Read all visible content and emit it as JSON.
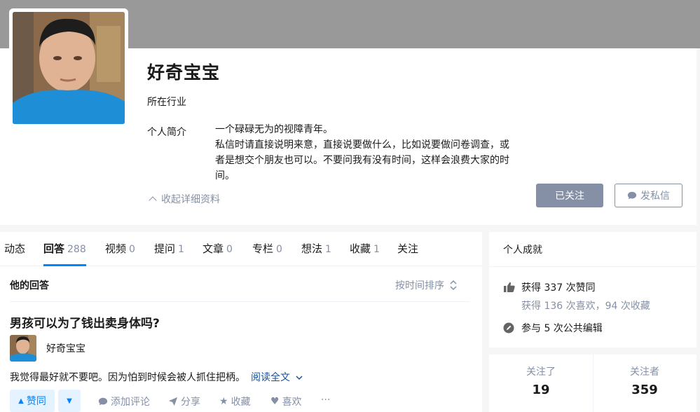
{
  "profile": {
    "name": "好奇宝宝",
    "industry_label": "所在行业",
    "bio_label": "个人简介",
    "bio_lines": [
      "一个碌碌无为的视障青年。",
      "私信时请直接说明来意，直接说要做什么，比如说要做问卷调查，或",
      "者是想交个朋友也可以。不要问我有没有时间，这样会浪费大家的时",
      "间。"
    ],
    "collapse_label": "收起详细资料",
    "followed_button": "已关注",
    "message_button": "发私信"
  },
  "tabs": [
    {
      "label": "动态",
      "count": ""
    },
    {
      "label": "回答",
      "count": "288"
    },
    {
      "label": "视频",
      "count": "0"
    },
    {
      "label": "提问",
      "count": "1"
    },
    {
      "label": "文章",
      "count": "0"
    },
    {
      "label": "专栏",
      "count": "0"
    },
    {
      "label": "想法",
      "count": "1"
    },
    {
      "label": "收藏",
      "count": "1"
    },
    {
      "label": "关注",
      "count": ""
    }
  ],
  "answers_section": {
    "title": "他的回答",
    "sort_label": "按时间排序",
    "question_title": "男孩可以为了钱出卖身体吗?",
    "author_name": "好奇宝宝",
    "excerpt": "我觉得最好就不要吧。因为怕到时候会被人抓住把柄。",
    "read_more": "阅读全文",
    "vote_up_label": "赞同",
    "actions": {
      "comment": "添加评论",
      "share": "分享",
      "collect": "收藏",
      "like": "喜欢",
      "more": "···"
    }
  },
  "achievements": {
    "title": "个人成就",
    "upvotes": "获得 337 次赞同",
    "likes_collects": "获得 136 次喜欢，94 次收藏",
    "edits": "参与 5 次公共编辑"
  },
  "follow_stats": {
    "following_label": "关注了",
    "following_count": "19",
    "followers_label": "关注者",
    "followers_count": "359"
  },
  "colors": {
    "accent": "#0084ff",
    "muted": "#8590a6",
    "cover": "#999999"
  }
}
